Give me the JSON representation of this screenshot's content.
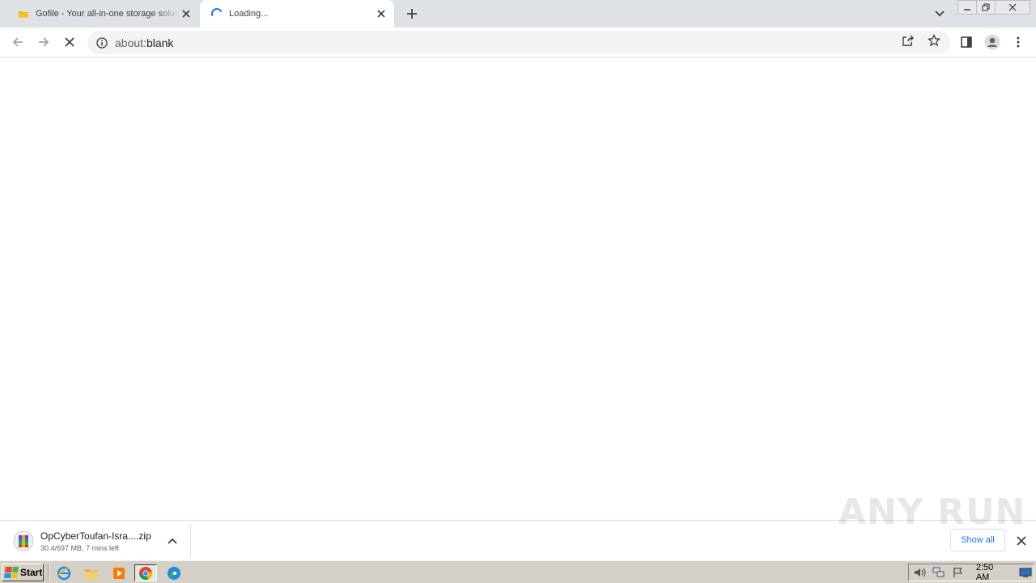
{
  "browser": {
    "tabs": [
      {
        "title": "Gofile - Your all-in-one storage solution",
        "active": false
      },
      {
        "title": "Loading...",
        "active": true
      }
    ],
    "address": {
      "url_host": "about:",
      "url_path": "blank"
    }
  },
  "download_bar": {
    "filename": "OpCyberToufan-Isra....zip",
    "status": "30.4/697 MB, 7 mins left",
    "show_all_label": "Show all",
    "watermark": "ANY RUN"
  },
  "taskbar": {
    "start_label": "Start",
    "clock": "2:50 AM"
  },
  "colors": {
    "tabstrip": "#dee1e6",
    "accent": "#1a73e8",
    "taskbar": "#d4d0c8"
  }
}
